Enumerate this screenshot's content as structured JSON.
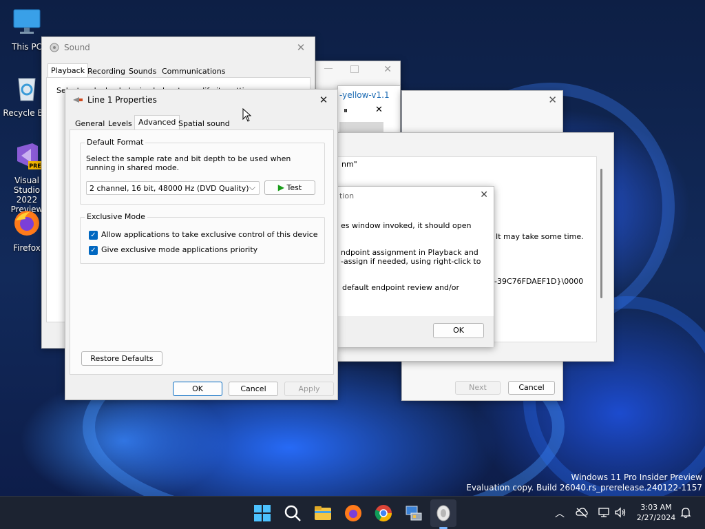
{
  "desktop": {
    "icons": [
      {
        "label": "This PC"
      },
      {
        "label": "Recycle Bin"
      },
      {
        "label": "Visual Studio 2022 Preview",
        "badge": "PRE"
      },
      {
        "label": "Firefox"
      }
    ],
    "watermark": {
      "line1": "Windows 11 Pro Insider Preview",
      "line2": "Evaluation copy. Build 26040.rs_prerelease.240122-1157"
    }
  },
  "sound_window": {
    "title": "Sound",
    "tabs": [
      "Playback",
      "Recording",
      "Sounds",
      "Communications"
    ],
    "active_tab": "Playback",
    "instruction": "Select a playback device below to modify its settings:"
  },
  "bg_window_yellow": {
    "title_fragment": "-yellow-v1.1",
    "pause_label": "⏸",
    "close_label": "✕"
  },
  "wizard_window": {
    "text_fragments": [
      "nm\"",
      "It may take some time.",
      "-39C76FDAEF1D}\\0000"
    ],
    "next_label": "Next",
    "cancel_label": "Cancel"
  },
  "info_dialog": {
    "title_fragment": "tion",
    "lines": [
      "es window invoked, it should open",
      "ndpoint assignment in Playback and",
      "-assign if needed, using right-click to",
      "default endpoint review and/or"
    ],
    "ok_label": "OK"
  },
  "properties_dialog": {
    "title": "Line 1 Properties",
    "tabs": [
      "General",
      "Levels",
      "Advanced",
      "Spatial sound"
    ],
    "active_tab": "Advanced",
    "default_format": {
      "group_label": "Default Format",
      "description": "Select the sample rate and bit depth to be used when running in shared mode.",
      "selected_format": "2 channel, 16 bit, 48000 Hz (DVD Quality)",
      "test_label": "Test"
    },
    "exclusive_mode": {
      "group_label": "Exclusive Mode",
      "options": [
        {
          "label": "Allow applications to take exclusive control of this device",
          "checked": true
        },
        {
          "label": "Give exclusive mode applications priority",
          "checked": true
        }
      ]
    },
    "restore_defaults_label": "Restore Defaults",
    "ok_label": "OK",
    "cancel_label": "Cancel",
    "apply_label": "Apply"
  },
  "taskbar": {
    "time": "3:03 AM",
    "date": "2/27/2024"
  },
  "colors": {
    "accent": "#0067c0",
    "taskbar": "#1c2331",
    "test_play": "#1a9c1a"
  }
}
